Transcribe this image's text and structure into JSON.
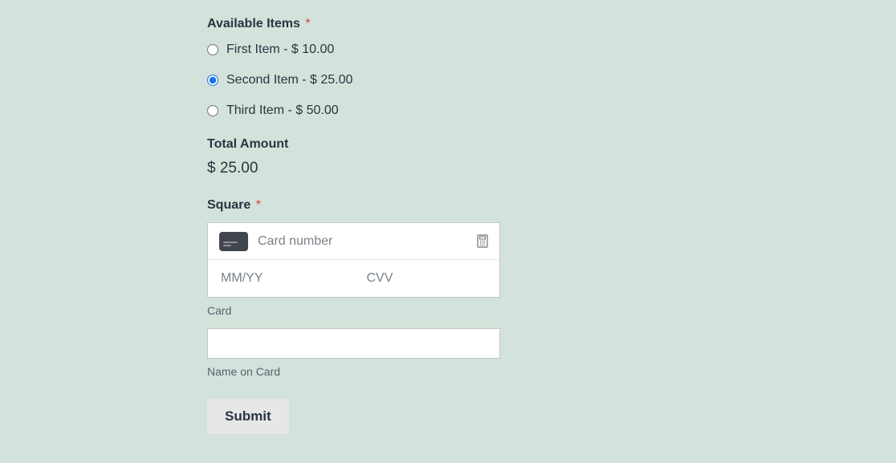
{
  "available_items": {
    "label": "Available Items",
    "required_mark": "*",
    "options": [
      {
        "label": "First Item - $ 10.00",
        "selected": false
      },
      {
        "label": "Second Item - $ 25.00",
        "selected": true
      },
      {
        "label": "Third Item - $ 50.00",
        "selected": false
      }
    ]
  },
  "total": {
    "label": "Total Amount",
    "value": "$ 25.00"
  },
  "square": {
    "label": "Square",
    "required_mark": "*",
    "card_number_placeholder": "Card number",
    "expiry_placeholder": "MM/YY",
    "cvv_placeholder": "CVV",
    "card_sublabel": "Card",
    "name_value": "",
    "name_sublabel": "Name on Card"
  },
  "submit": {
    "label": "Submit"
  }
}
